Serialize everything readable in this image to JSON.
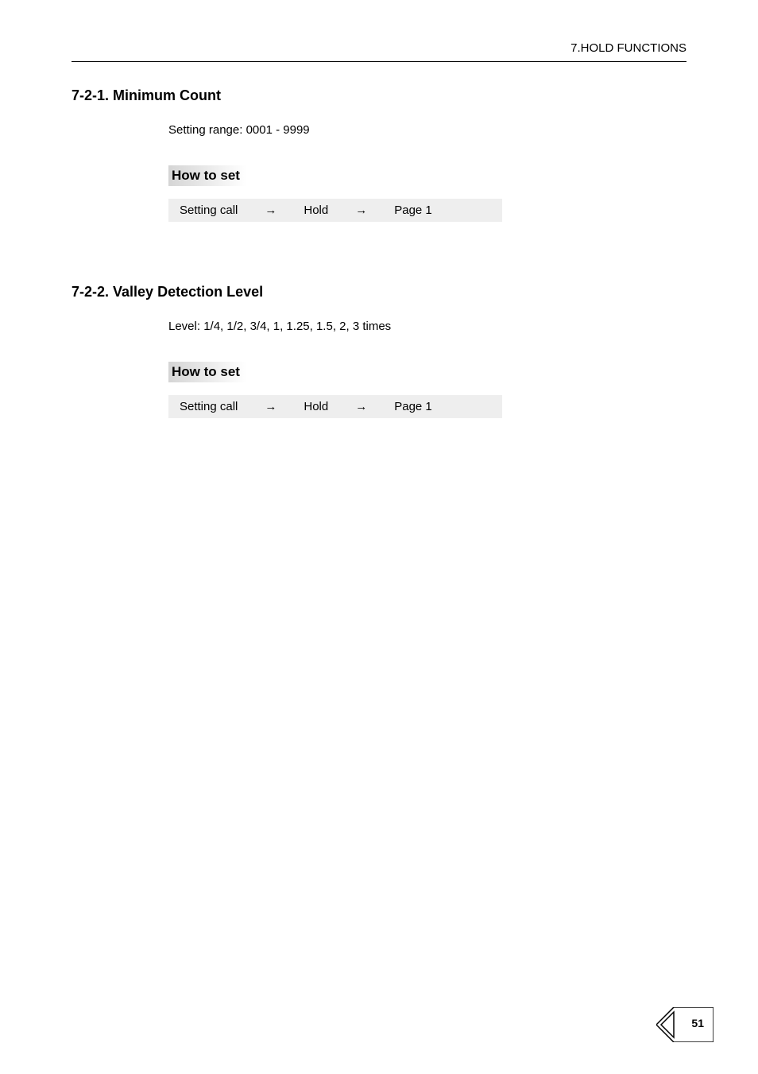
{
  "header": {
    "chapter": "7.HOLD FUNCTIONS"
  },
  "sections": [
    {
      "heading": "7-2-1. Minimum Count",
      "setting": "Setting range: 0001 - 9999",
      "howto_label": "How to set",
      "nav": {
        "a": "Setting call",
        "arrow": "→",
        "b": "Hold",
        "c": "Page 1"
      }
    },
    {
      "heading": "7-2-2. Valley Detection Level",
      "setting": "Level: 1/4, 1/2, 3/4, 1, 1.25, 1.5, 2, 3 times",
      "howto_label": "How to set",
      "nav": {
        "a": "Setting call",
        "arrow": "→",
        "b": "Hold",
        "c": "Page 1"
      }
    }
  ],
  "page_number": "51"
}
